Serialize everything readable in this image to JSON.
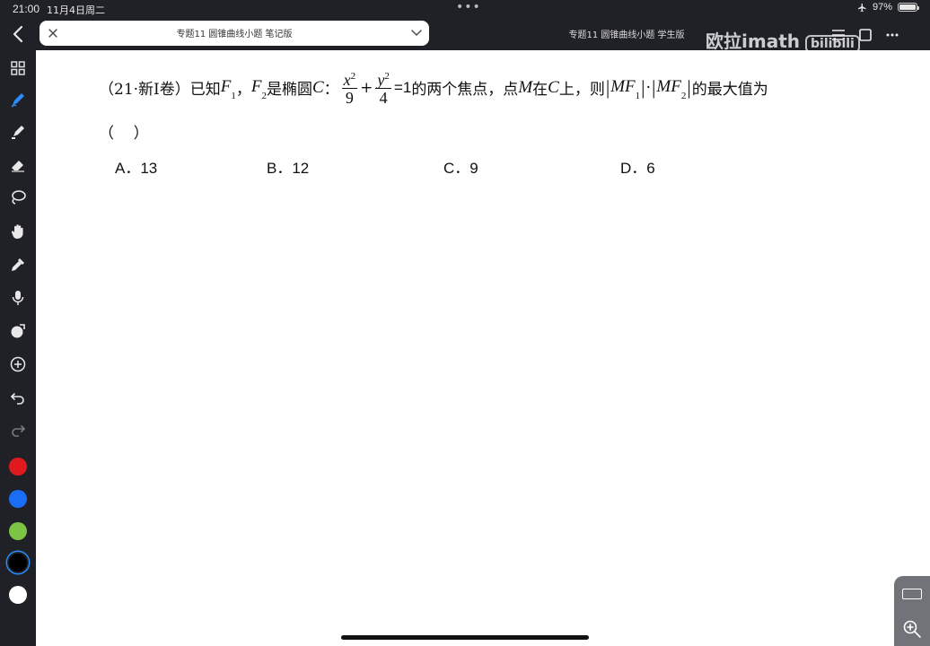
{
  "status": {
    "time": "21:00",
    "date": "11月4日周二",
    "dots": "•••",
    "battery_percent": "97%",
    "battery_level": 0.97
  },
  "tabs": {
    "active_title": "专题11 圆锥曲线小题 笔记版",
    "inactive_title": "专题11 圆锥曲线小题 学生版"
  },
  "watermark": {
    "text": "欧拉imath",
    "logo": "bilibili"
  },
  "tools": [
    "back-icon",
    "grid-icon",
    "pen-icon",
    "highlighter-icon",
    "eraser-icon",
    "lasso-icon",
    "hand-icon",
    "eyedropper-icon",
    "mic-icon",
    "shape-icon",
    "add-icon",
    "undo-icon",
    "redo-icon"
  ],
  "colors": {
    "red": "#e0191f",
    "blue": "#1a6ef5",
    "green": "#7cc443",
    "black": "#000000",
    "white": "#ffffff",
    "toolbar_bg": "#1f2126",
    "selected_ring": "#2a8cff"
  },
  "question": {
    "source": "（21·新Ⅰ卷）",
    "part1": "已知",
    "F": "F",
    "sub1": "1",
    "comma": "，",
    "sub2": "2",
    "part2": "是椭圆",
    "C": "C",
    "colon": "：",
    "num1": "x",
    "exp": "2",
    "den1": "9",
    "plus": "+",
    "num2": "y",
    "den2": "4",
    "eq": "=1",
    "part3": "的两个焦点，点",
    "M": "M",
    "part4": "在",
    "part5": "上，则",
    "MF": "MF",
    "dot": "·",
    "part6": "的最大值为",
    "blank": "（    ）"
  },
  "choices": [
    {
      "label": "A．13"
    },
    {
      "label": "B．12"
    },
    {
      "label": "C．9"
    },
    {
      "label": "D．6"
    }
  ]
}
